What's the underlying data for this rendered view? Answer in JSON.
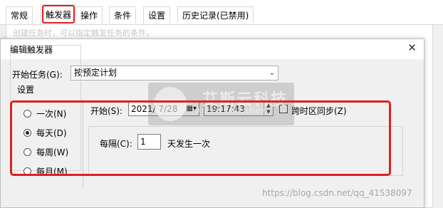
{
  "tabs": [
    {
      "label": "常规",
      "active": false
    },
    {
      "label": "触发器",
      "active": true
    },
    {
      "label": "操作",
      "active": false
    },
    {
      "label": "条件",
      "active": false
    },
    {
      "label": "设置",
      "active": false
    },
    {
      "label": "历史记录(已禁用)",
      "active": false
    }
  ],
  "background_hint": "创建任务时，可以指定触发任务的条件。",
  "dialog": {
    "title": "编辑触发器",
    "close_glyph": "✕",
    "begin_task_label": "开始任务(G):",
    "begin_task_value": "按预定计划",
    "settings_label": "设置",
    "schedule_options": [
      {
        "label": "一次(N)",
        "checked": false
      },
      {
        "label": "每天(D)",
        "checked": true
      },
      {
        "label": "每周(W)",
        "checked": false
      },
      {
        "label": "每月(M)",
        "checked": false
      }
    ],
    "start_label": "开始(S):",
    "start_date": "2021/ 7/28",
    "start_time": "19:17:43",
    "sync_timezone_label": "跨时区同步(Z)",
    "sync_timezone_checked": false,
    "recur_every_label": "每隔(C):",
    "recur_every_value": "1",
    "recur_unit_label": "天发生一次"
  },
  "watermark": {
    "logo_text": "艾斯云科技",
    "logo_sub": "AISI TECHNOLOGY",
    "url_text": "https://blog.csdn.net/qq_41538097"
  },
  "colors": {
    "highlight": "#e02020",
    "window_bg": "#f0f0f0"
  }
}
